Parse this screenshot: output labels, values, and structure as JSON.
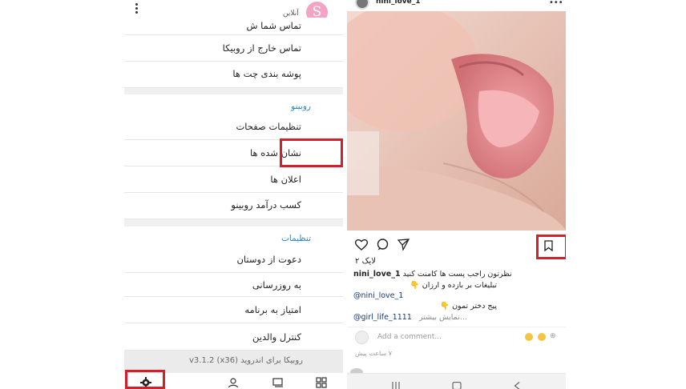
{
  "left": {
    "avatar_letter": "S",
    "online_label": "آنلاین",
    "rows_top": [
      "تماس شما ش",
      "تماس خارج از روبیکا",
      "پوشه بندی چت ها"
    ],
    "rubino_section": "روبینو",
    "rubino_items": [
      "تنظیمات صفحات",
      "نشان شده ها",
      "اعلان ها",
      "کسب درآمد روبینو"
    ],
    "settings_section": "تنظیمات",
    "settings_items": [
      "دعوت از دوستان",
      "به روزرسانی",
      "امتیاز به برنامه",
      "کنترل والدین"
    ],
    "version": "روبیکا برای اندروید v3.1.2 (x36)",
    "highlight_color": "#d4202a",
    "bottom_nav_icons": [
      "gear-icon",
      "people-icon",
      "chat-icon",
      "grid-icon"
    ]
  },
  "right": {
    "username": "nini_love_1",
    "likes": "۲ لایک",
    "caption_user": "nini_love_1",
    "caption_line1": "نظرتون راجب پست ها کامنت کنید",
    "caption_line2": "تبلیغات بر بازده و ارزان 👇",
    "caption_line3": "@nini_love_1",
    "caption_line4": "پیج دختر تمون 👇",
    "caption_line5": "@girl_life_1111",
    "more_label": "نمایش بیشتر...",
    "comment_placeholder": "Add a comment...",
    "time": "۷ ساعت پیش"
  }
}
